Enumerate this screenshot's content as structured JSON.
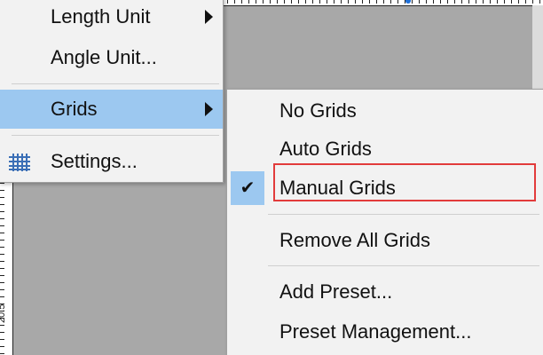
{
  "main_menu": {
    "items": [
      {
        "label": "Length Unit",
        "has_submenu": true
      },
      {
        "label": "Angle Unit...",
        "has_submenu": false
      },
      {
        "label": "Grids",
        "has_submenu": true,
        "highlighted": true
      },
      {
        "label": "Settings...",
        "has_submenu": false,
        "icon": "grid-settings-icon"
      }
    ]
  },
  "grids_submenu": {
    "items": [
      {
        "label": "No Grids"
      },
      {
        "label": "Auto Grids"
      },
      {
        "label": "Manual Grids",
        "checked": true,
        "check_glyph": "✔",
        "annotated": true
      },
      {
        "label": "Remove All Grids"
      },
      {
        "label": "Add Preset..."
      },
      {
        "label": "Preset Management..."
      }
    ]
  },
  "ruler": {
    "left_number": "20.5"
  },
  "colors": {
    "highlight": "#9cc8f0",
    "annotation": "#e23b3b",
    "menu_bg": "#f2f2f2",
    "workspace": "#a8a8a8",
    "icon_blue": "#3b6fb6"
  }
}
